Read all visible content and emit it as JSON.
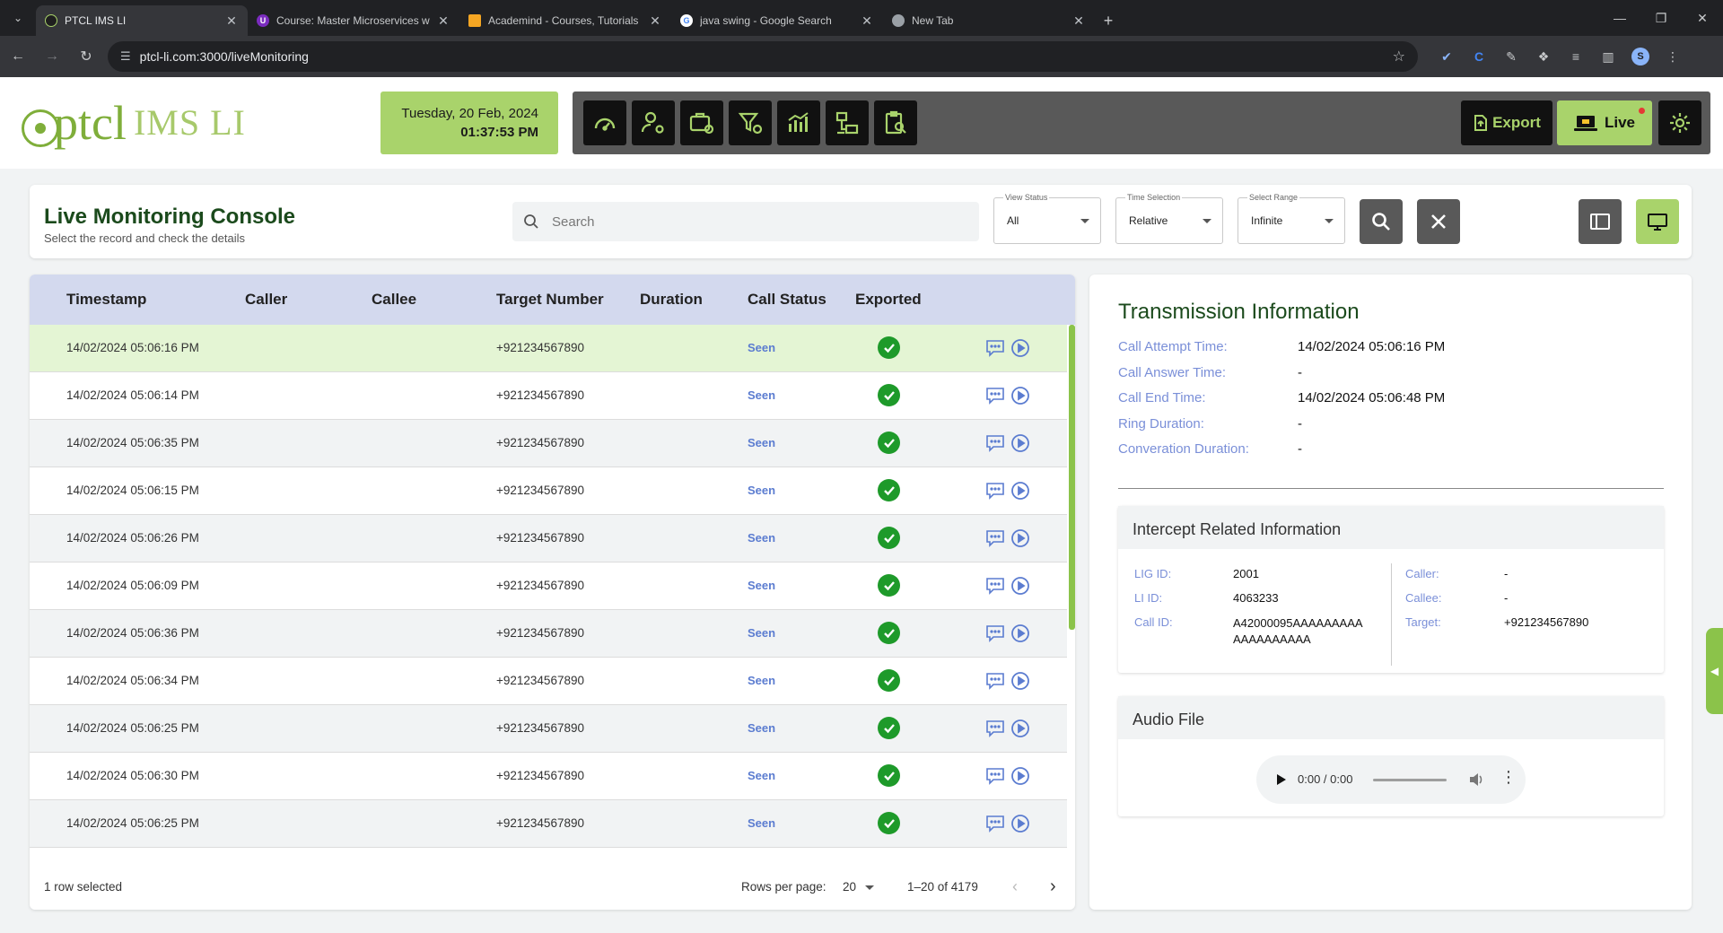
{
  "browser": {
    "tabs": [
      {
        "title": "PTCL IMS LI",
        "active": true,
        "favicon_color": "#1f1f1f"
      },
      {
        "title": "Course: Master Microservices w",
        "active": false,
        "favicon_color": "#7b2cbf"
      },
      {
        "title": "Academind - Courses, Tutorials",
        "active": false,
        "favicon_color": "#f5a623"
      },
      {
        "title": "java swing - Google Search",
        "active": false,
        "favicon_color": "#4285f4"
      },
      {
        "title": "New Tab",
        "active": false,
        "favicon_color": "#9aa0a6"
      }
    ],
    "url": "ptcl-li.com:3000/liveMonitoring",
    "profile_initial": "S"
  },
  "header": {
    "logo_text": "ptcl",
    "logo_sub": "IMS LI",
    "date": "Tuesday, 20 Feb, 2024",
    "time": "01:37:53 PM",
    "nav_icons": [
      "dashboard-icon",
      "user-settings-icon",
      "case-settings-icon",
      "filter-settings-icon",
      "analytics-icon",
      "network-icon",
      "report-search-icon"
    ],
    "export_label": "Export",
    "live_label": "Live",
    "colors": {
      "accent": "#a9d36b",
      "dark": "#111111",
      "bar": "#595959",
      "title_green": "#1b4a1c"
    }
  },
  "console": {
    "title": "Live Monitoring Console",
    "subtitle": "Select the record and check the details",
    "search_placeholder": "Search",
    "filters": [
      {
        "label": "View Status",
        "value": "All"
      },
      {
        "label": "Time Selection",
        "value": "Relative"
      },
      {
        "label": "Select Range",
        "value": "Infinite"
      }
    ]
  },
  "table": {
    "columns": [
      "Timestamp",
      "Caller",
      "Callee",
      "Target Number",
      "Duration",
      "Call Status",
      "Exported"
    ],
    "rows": [
      {
        "timestamp": "14/02/2024 05:06:16 PM",
        "caller": "",
        "callee": "",
        "target": "+921234567890",
        "duration": "",
        "status": "Seen"
      },
      {
        "timestamp": "14/02/2024 05:06:14 PM",
        "caller": "",
        "callee": "",
        "target": "+921234567890",
        "duration": "",
        "status": "Seen"
      },
      {
        "timestamp": "14/02/2024 05:06:35 PM",
        "caller": "",
        "callee": "",
        "target": "+921234567890",
        "duration": "",
        "status": "Seen"
      },
      {
        "timestamp": "14/02/2024 05:06:15 PM",
        "caller": "",
        "callee": "",
        "target": "+921234567890",
        "duration": "",
        "status": "Seen"
      },
      {
        "timestamp": "14/02/2024 05:06:26 PM",
        "caller": "",
        "callee": "",
        "target": "+921234567890",
        "duration": "",
        "status": "Seen"
      },
      {
        "timestamp": "14/02/2024 05:06:09 PM",
        "caller": "",
        "callee": "",
        "target": "+921234567890",
        "duration": "",
        "status": "Seen"
      },
      {
        "timestamp": "14/02/2024 05:06:36 PM",
        "caller": "",
        "callee": "",
        "target": "+921234567890",
        "duration": "",
        "status": "Seen"
      },
      {
        "timestamp": "14/02/2024 05:06:34 PM",
        "caller": "",
        "callee": "",
        "target": "+921234567890",
        "duration": "",
        "status": "Seen"
      },
      {
        "timestamp": "14/02/2024 05:06:25 PM",
        "caller": "",
        "callee": "",
        "target": "+921234567890",
        "duration": "",
        "status": "Seen"
      },
      {
        "timestamp": "14/02/2024 05:06:30 PM",
        "caller": "",
        "callee": "",
        "target": "+921234567890",
        "duration": "",
        "status": "Seen"
      },
      {
        "timestamp": "14/02/2024 05:06:25 PM",
        "caller": "",
        "callee": "",
        "target": "+921234567890",
        "duration": "",
        "status": "Seen"
      }
    ],
    "selected_row": 0,
    "footer": {
      "selected_text": "1 row selected",
      "rows_per_page_label": "Rows per page:",
      "rows_per_page": "20",
      "range": "1–20 of 4179"
    }
  },
  "details": {
    "title": "Transmission Information",
    "fields": [
      {
        "key": "Call Attempt Time:",
        "value": "14/02/2024 05:06:16 PM"
      },
      {
        "key": "Call Answer Time:",
        "value": "-"
      },
      {
        "key": "Call End Time:",
        "value": "14/02/2024 05:06:48 PM"
      },
      {
        "key": "Ring Duration:",
        "value": "-"
      },
      {
        "key": "Converation Duration:",
        "value": "-"
      }
    ],
    "intercept": {
      "title": "Intercept Related Information",
      "left": [
        {
          "key": "LIG ID:",
          "value": "2001"
        },
        {
          "key": "LI ID:",
          "value": "4063233"
        },
        {
          "key": "Call ID:",
          "value": "A42000095AAAAAAAAA AAAAAAAAAA"
        }
      ],
      "right": [
        {
          "key": "Caller:",
          "value": "-"
        },
        {
          "key": "Callee:",
          "value": "-"
        },
        {
          "key": "Target:",
          "value": "+921234567890"
        }
      ]
    },
    "audio": {
      "title": "Audio File",
      "time": "0:00 / 0:00"
    }
  }
}
